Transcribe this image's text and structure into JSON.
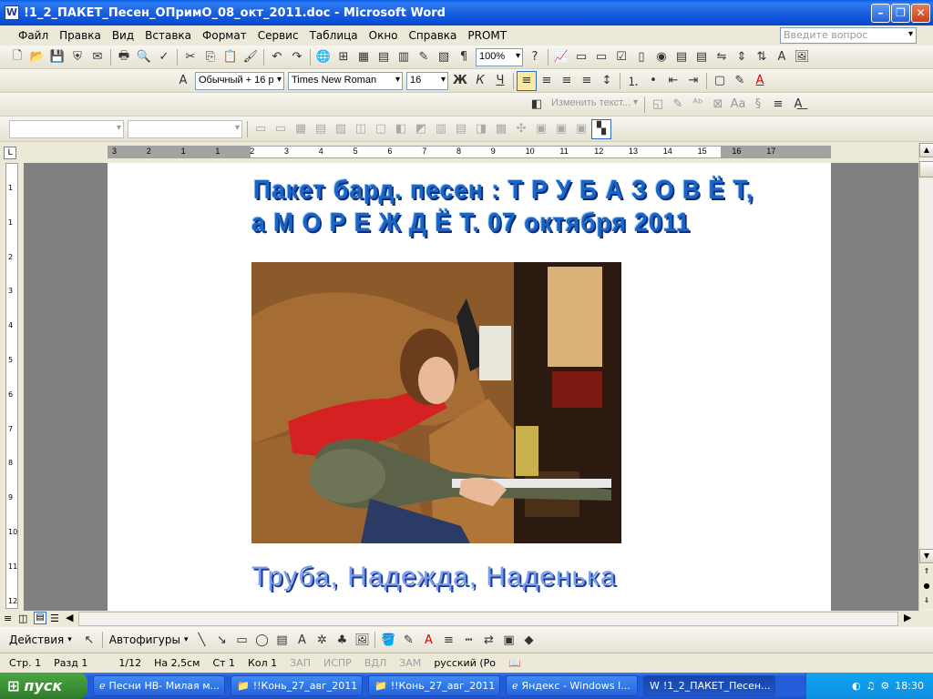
{
  "window": {
    "title": "!1_2_ПАКЕТ_Песен_ОПримО_08_окт_2011.doc - Microsoft Word",
    "minimize": "–",
    "maximize": "❐",
    "close": "✕"
  },
  "menu": {
    "items": [
      "Файл",
      "Правка",
      "Вид",
      "Вставка",
      "Формат",
      "Сервис",
      "Таблица",
      "Окно",
      "Справка",
      "PROMT"
    ],
    "ask_placeholder": "Введите вопрос"
  },
  "standard_toolbar": {
    "zoom": "100%"
  },
  "format_toolbar": {
    "style": "Обычный + 16 р",
    "font": "Times New Roman",
    "size": "16",
    "bold": "Ж",
    "italic": "К",
    "underline": "Ч"
  },
  "promt_toolbar": {
    "edit_text": "Изменить текст..."
  },
  "ruler": {
    "ticks": [
      "3",
      "2",
      "1",
      "1",
      "2",
      "3",
      "4",
      "5",
      "6",
      "7",
      "8",
      "9",
      "10",
      "11",
      "12",
      "13",
      "14",
      "15",
      "16",
      "17"
    ]
  },
  "vertical_ruler": {
    "ticks": [
      "1",
      "1",
      "2",
      "3",
      "4",
      "5",
      "6",
      "7",
      "8",
      "9",
      "10",
      "11",
      "12",
      "13"
    ]
  },
  "document": {
    "heading_line1": "Пакет бард. песен : Т Р У Б А   З О В Ё Т,",
    "heading_line2": "а   М О Р Е   Ж Д Ё Т.   07 октября 2011",
    "caption": "Труба, Надежда, Наденька"
  },
  "drawing_toolbar": {
    "actions": "Действия",
    "autoshapes": "Автофигуры"
  },
  "status": {
    "page": "Стр. 1",
    "section": "Разд 1",
    "pages": "1/12",
    "at": "На 2,5см",
    "line": "Ст 1",
    "col": "Кол 1",
    "rec": "ЗАП",
    "trk": "ИСПР",
    "ext": "ВДЛ",
    "ovr": "ЗАМ",
    "lang": "русский (Ро"
  },
  "taskbar": {
    "start": "пуск",
    "tasks": [
      "Песни НВ- Милая м...",
      "!!Конь_27_авг_2011",
      "!!Конь_27_авг_2011",
      "Яндекс - Windows I...",
      "!1_2_ПАКЕТ_Песен..."
    ],
    "clock": "18:30"
  },
  "colors": {
    "titlebar": "#0a5ce8",
    "wordart": "#1a66c4",
    "caption": "#7a9ee8"
  }
}
